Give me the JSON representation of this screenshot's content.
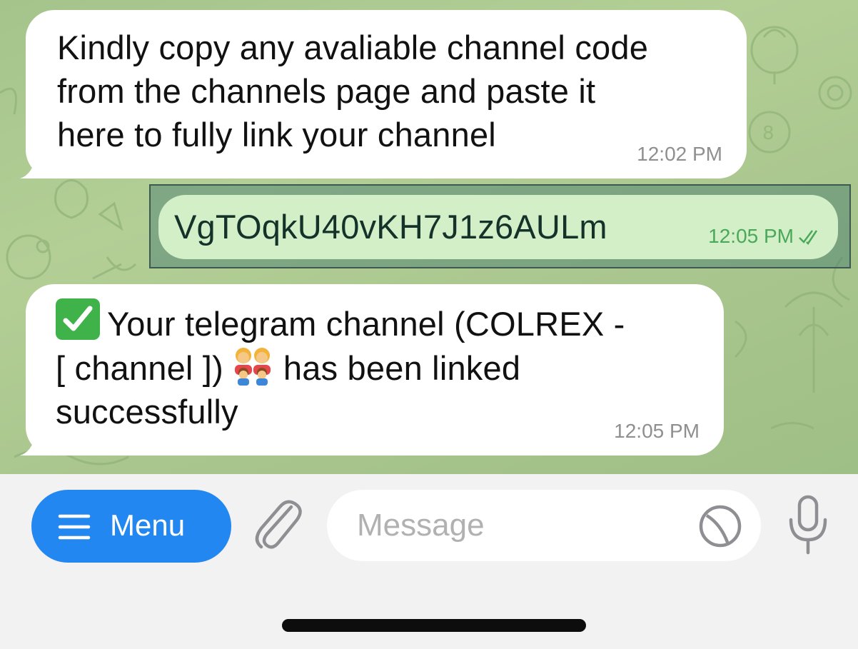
{
  "messages": [
    {
      "direction": "incoming",
      "text": "Kindly copy any avaliable channel code\nfrom the channels page and paste it\nhere to fully link your channel",
      "time": "12:02 PM"
    },
    {
      "direction": "outgoing",
      "text": "VgTOqkU40vKH7J1z6AULm",
      "time": "12:05 PM",
      "status_icon": "double-check-icon",
      "selected": true
    },
    {
      "direction": "incoming",
      "line1": "Your telegram channel (COLREX -",
      "line2_before": "[ channel ])",
      "line2_after": "has been linked",
      "line3": "successfully",
      "time": "12:05 PM",
      "emojis": [
        "check-mark-button-emoji",
        "family-emoji"
      ]
    }
  ],
  "input_bar": {
    "menu_label": "Menu",
    "message_placeholder": "Message",
    "icons": [
      "menu-hamburger-icon",
      "paperclip-icon",
      "sticker-icon",
      "microphone-icon"
    ]
  },
  "colors": {
    "wallpaper": "#a9c68e",
    "incoming_bubble": "#ffffff",
    "outgoing_bubble": "#d3efc7",
    "accent": "#2287f0",
    "read_checks": "#4ba85a"
  }
}
